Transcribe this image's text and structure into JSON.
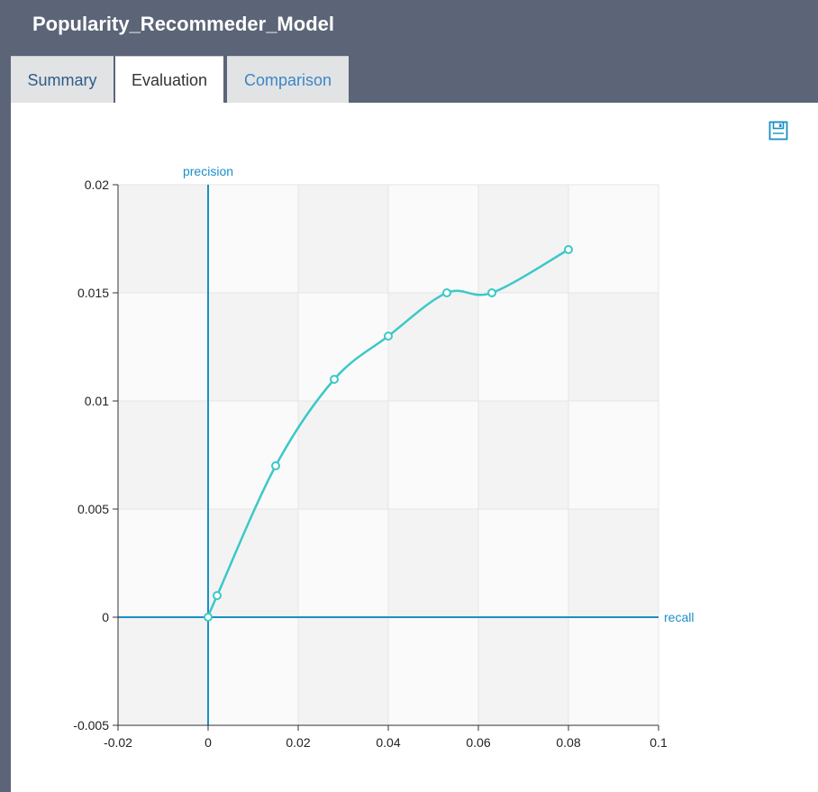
{
  "app": {
    "title": "Popularity_Recommeder_Model"
  },
  "tabs": [
    {
      "label": "Summary",
      "active": false
    },
    {
      "label": "Evaluation",
      "active": true
    },
    {
      "label": "Comparison",
      "active": false
    }
  ],
  "toolbar": {
    "save_icon": "save-icon"
  },
  "colors": {
    "axis": "#1a8fc7",
    "series": "#3cc8c8",
    "header": "#5b6577"
  },
  "chart_data": {
    "type": "line",
    "title": "",
    "xlabel": "recall",
    "ylabel": "precision",
    "xlim": [
      -0.02,
      0.1
    ],
    "ylim": [
      -0.005,
      0.02
    ],
    "x_ticks": [
      "-0.02",
      "0",
      "0.02",
      "0.04",
      "0.06",
      "0.08",
      "0.1"
    ],
    "y_ticks": [
      "0.02",
      "0.015",
      "0.01",
      "0.005",
      "0",
      "-0.005"
    ],
    "grid": true,
    "series": [
      {
        "x": [
          0,
          0.002,
          0.015,
          0.028,
          0.04,
          0.053,
          0.063,
          0.08
        ],
        "y": [
          0,
          0.001,
          0.007,
          0.011,
          0.013,
          0.015,
          0.015,
          0.017
        ]
      }
    ]
  }
}
